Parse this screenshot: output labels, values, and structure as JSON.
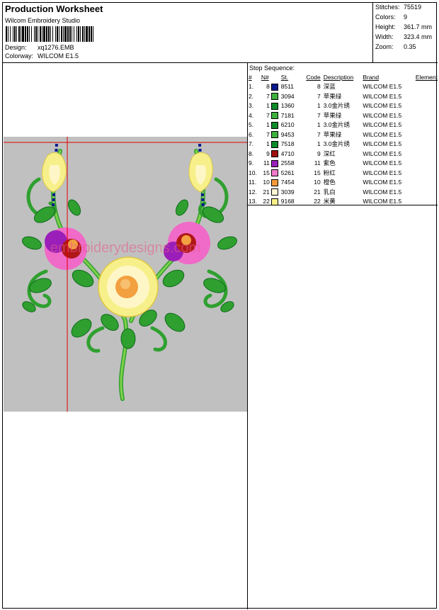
{
  "header": {
    "title": "Production Worksheet",
    "software": "Wilcom  Embroidery Studio",
    "design_label": "Design:",
    "design_value": "xq1276.EMB",
    "colorway_label": "Colorway:",
    "colorway_value": "WILCOM E1.5"
  },
  "stats": [
    {
      "label": "Stitches:",
      "value": "75519"
    },
    {
      "label": "Colors:",
      "value": "9"
    },
    {
      "label": "Height:",
      "value": "361.7 mm"
    },
    {
      "label": "Width:",
      "value": "323.4 mm"
    },
    {
      "label": "Zoom:",
      "value": "0.35"
    }
  ],
  "sequence": {
    "title": "Stop Sequence:",
    "headers": {
      "idx": "#",
      "n": "N#",
      "st": "St.",
      "code": "Code",
      "desc": "Description",
      "brand": "Brand",
      "element": "Element"
    },
    "rows": [
      {
        "idx": "1.",
        "n": "8",
        "color": "#0a1a8c",
        "st": "8511",
        "code": "8",
        "desc": "深蓝",
        "brand": "WILCOM E1.5"
      },
      {
        "idx": "2.",
        "n": "7",
        "color": "#3db03d",
        "st": "3094",
        "code": "7",
        "desc": "苹果绿",
        "brand": "WILCOM E1.5"
      },
      {
        "idx": "3.",
        "n": "1",
        "color": "#0d8a2a",
        "st": "1360",
        "code": "1",
        "desc": "3.0金片绣",
        "brand": "WILCOM E1.5"
      },
      {
        "idx": "4.",
        "n": "7",
        "color": "#3db03d",
        "st": "7181",
        "code": "7",
        "desc": "苹果绿",
        "brand": "WILCOM E1.5"
      },
      {
        "idx": "5.",
        "n": "1",
        "color": "#0d8a2a",
        "st": "6210",
        "code": "1",
        "desc": "3.0金片绣",
        "brand": "WILCOM E1.5"
      },
      {
        "idx": "6.",
        "n": "7",
        "color": "#3db03d",
        "st": "9453",
        "code": "7",
        "desc": "苹果绿",
        "brand": "WILCOM E1.5"
      },
      {
        "idx": "7.",
        "n": "1",
        "color": "#0d8a2a",
        "st": "7518",
        "code": "1",
        "desc": "3.0金片绣",
        "brand": "WILCOM E1.5"
      },
      {
        "idx": "8.",
        "n": "9",
        "color": "#a01010",
        "st": "4710",
        "code": "9",
        "desc": "深红",
        "brand": "WILCOM E1.5"
      },
      {
        "idx": "9.",
        "n": "11",
        "color": "#9a1fb8",
        "st": "2558",
        "code": "11",
        "desc": "紫色",
        "brand": "WILCOM E1.5"
      },
      {
        "idx": "10.",
        "n": "15",
        "color": "#f27ac8",
        "st": "5261",
        "code": "15",
        "desc": "粉红",
        "brand": "WILCOM E1.5"
      },
      {
        "idx": "11.",
        "n": "10",
        "color": "#f59a3a",
        "st": "7454",
        "code": "10",
        "desc": "橙色",
        "brand": "WILCOM E1.5"
      },
      {
        "idx": "12.",
        "n": "21",
        "color": "#fff6d6",
        "st": "3039",
        "code": "21",
        "desc": "乳白",
        "brand": "WILCOM E1.5"
      },
      {
        "idx": "13.",
        "n": "22",
        "color": "#f7f08a",
        "st": "9168",
        "code": "22",
        "desc": "米黄",
        "brand": "WILCOM E1.5"
      }
    ]
  },
  "design": {
    "marker_left": "1",
    "marker_right": "2",
    "watermark": "embroiderydesigns.com",
    "palette": {
      "background": "#c0c0c0",
      "leaf": "#2fa02f",
      "leaf_light": "#7ed04a",
      "outline": "#0a1a8c",
      "pink": "#f06ac8",
      "purple": "#9a1fb8",
      "red": "#b01818",
      "yellow": "#f7f08a",
      "cream": "#fff6c8",
      "orange": "#f2a040"
    }
  }
}
